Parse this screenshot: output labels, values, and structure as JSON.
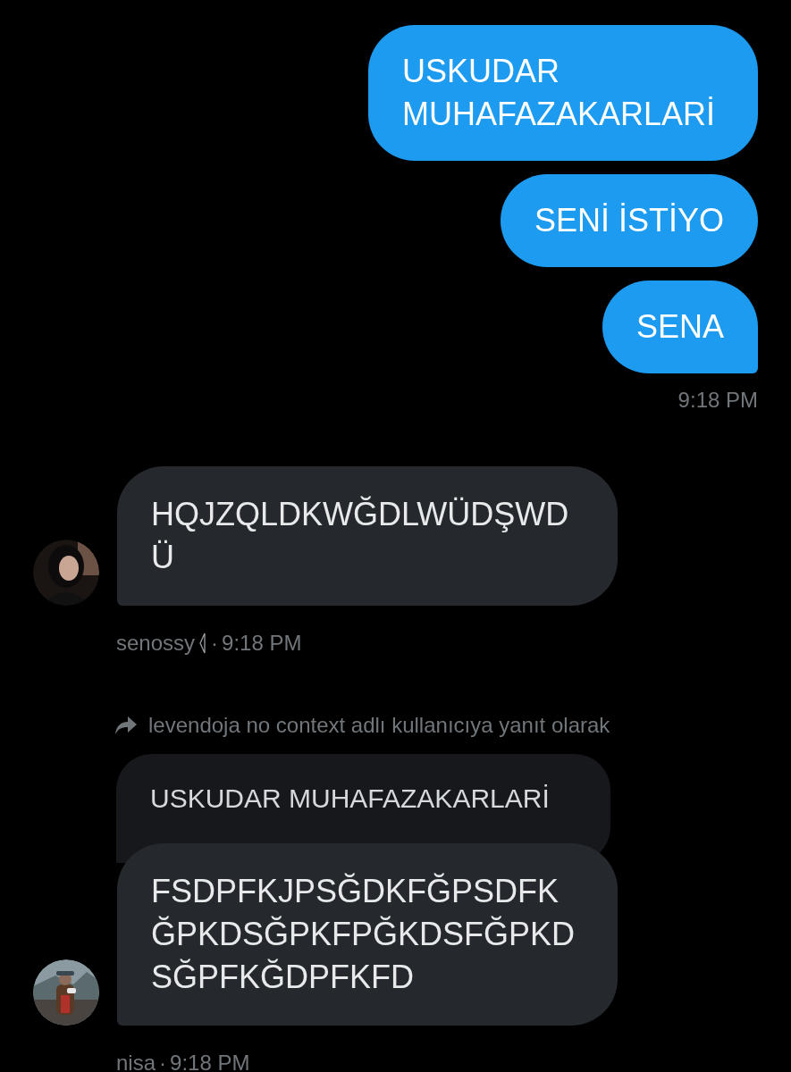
{
  "sent": {
    "bubbles": [
      {
        "text": "USKUDAR MUHAFAZAKARLARİ"
      },
      {
        "text": "SENİ İSTİYO"
      },
      {
        "text": "SENA"
      }
    ],
    "time": "9:18 PM"
  },
  "received": [
    {
      "author": "senossy",
      "badge": true,
      "separator": "·",
      "time": "9:18 PM",
      "bubbles": [
        {
          "text": "HQJZQLDKWĞDLWÜDŞWDÜ"
        }
      ]
    },
    {
      "reply_to": "levendoja no context adlı kullanıcıya yanıt olarak",
      "quoted": "USKUDAR MUHAFAZAKARLARİ",
      "author": "nisa",
      "badge": false,
      "separator": "·",
      "time": "9:18 PM",
      "bubbles": [
        {
          "text": "FSDPFKJPSĞDKFĞPSDFKĞPKDSĞPKFPĞKDSFĞPKDSĞPFKĞDPFKFD"
        }
      ]
    }
  ]
}
